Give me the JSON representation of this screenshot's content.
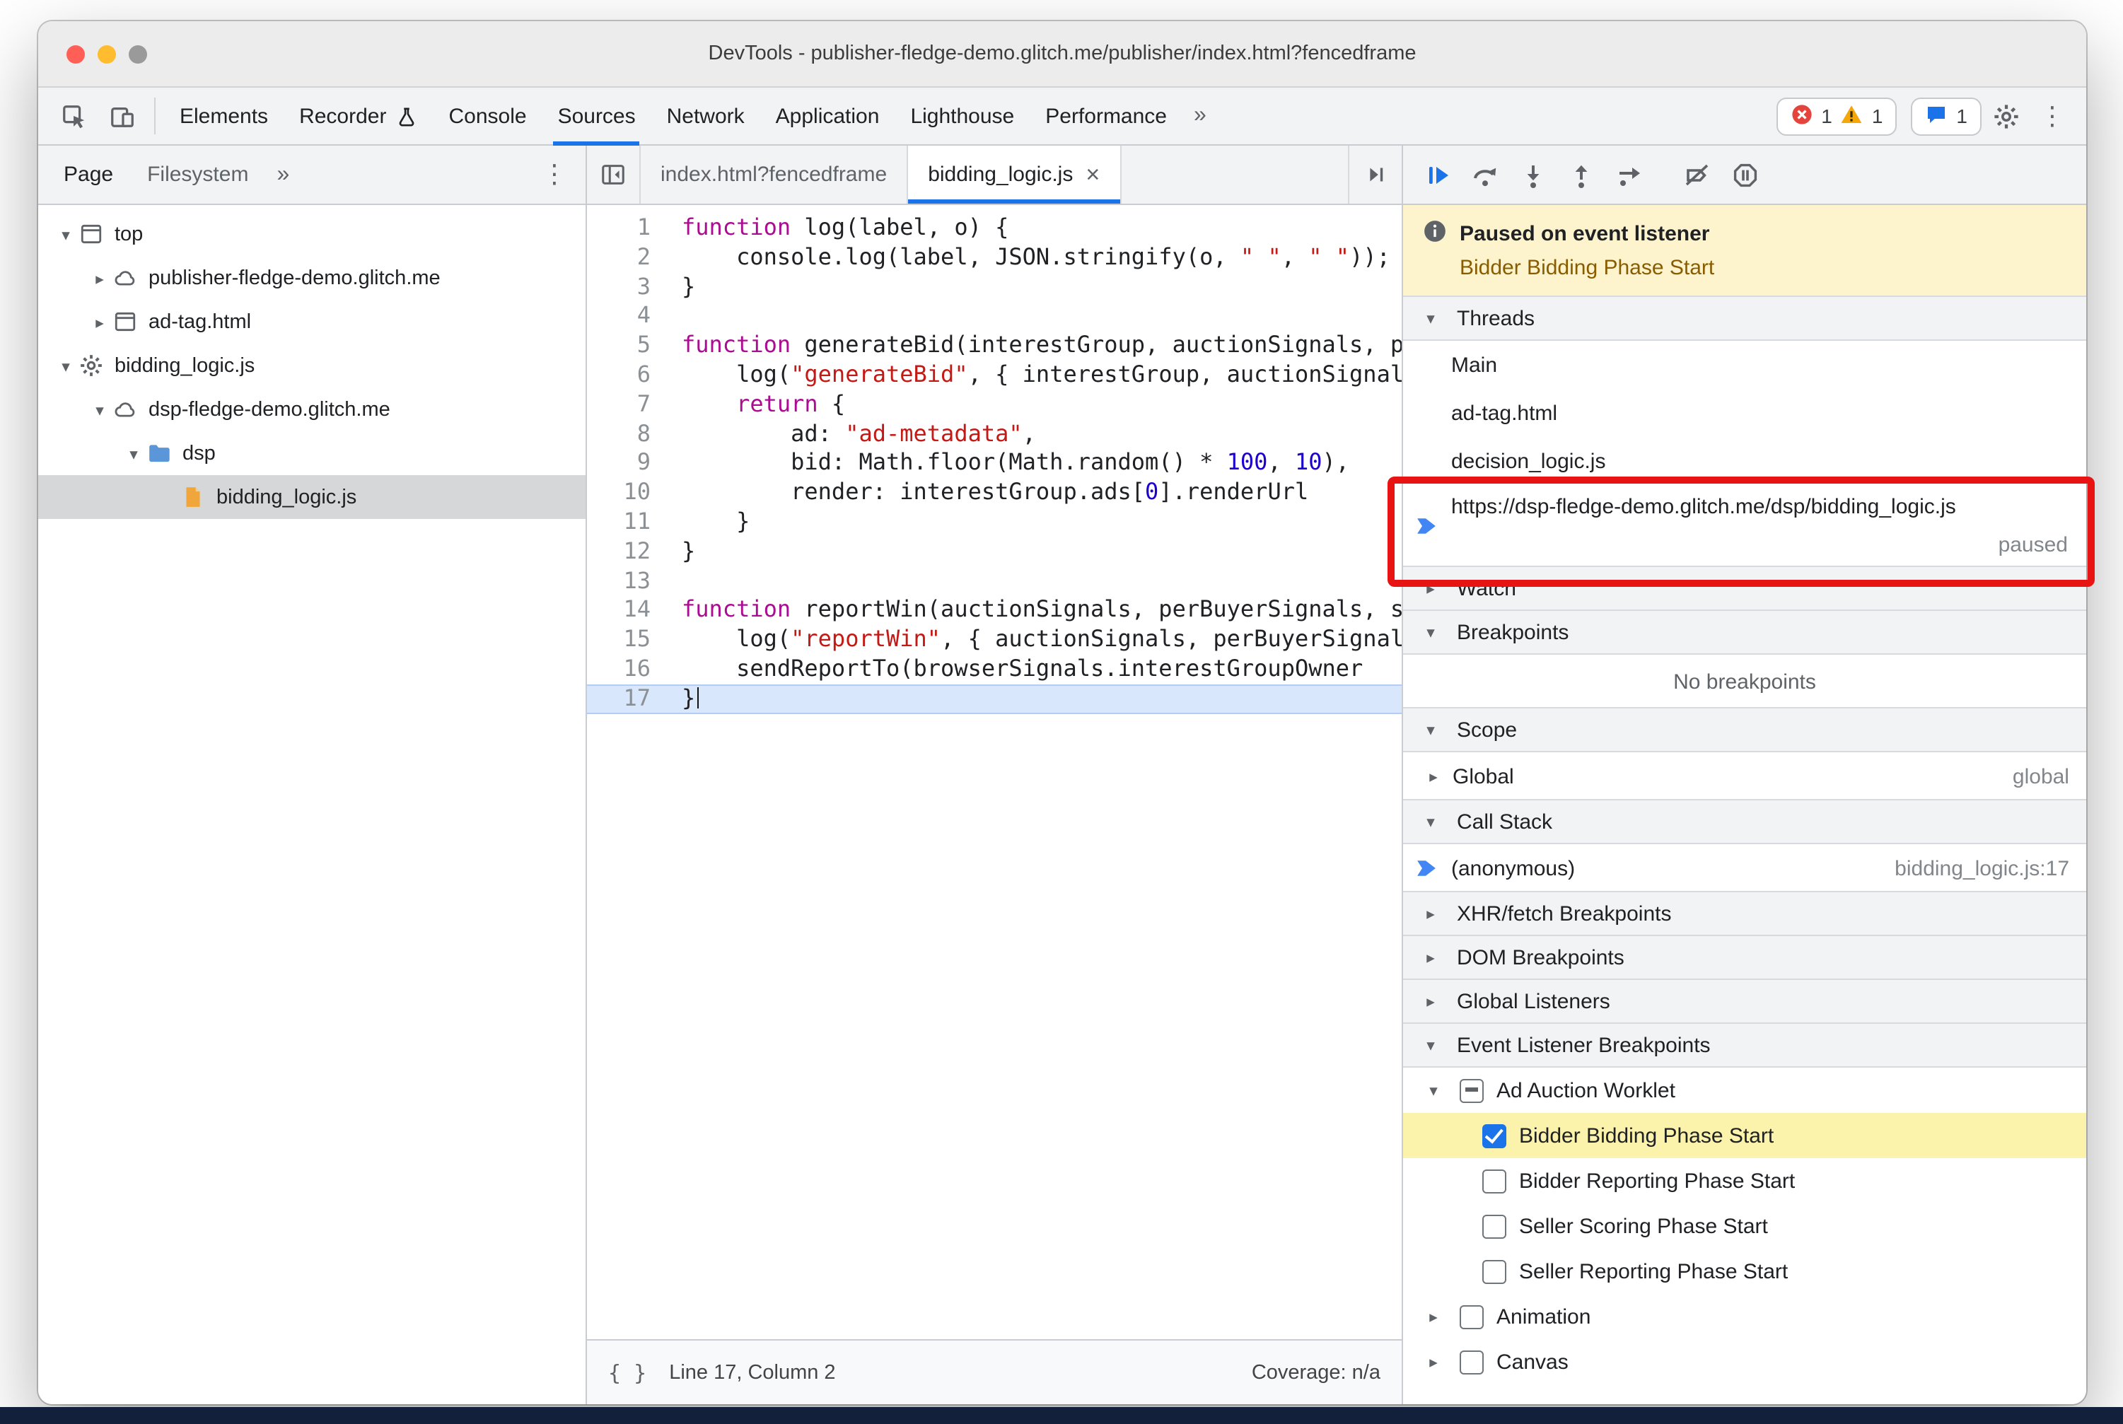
{
  "window": {
    "title": "DevTools - publisher-fledge-demo.glitch.me/publisher/index.html?fencedframe"
  },
  "glyphs": {
    "kebab": "⋮",
    "more": "»",
    "expanded": "▾",
    "collapsed": "▸",
    "close": "×",
    "pretty": "{ }"
  },
  "toolbar": {
    "tabs": [
      "Elements",
      "Recorder",
      "Console",
      "Sources",
      "Network",
      "Application",
      "Lighthouse",
      "Performance"
    ],
    "active_tab": "Sources",
    "error_count": "1",
    "warning_count": "1",
    "issue_count": "1"
  },
  "navigator": {
    "tabs": [
      "Page",
      "Filesystem"
    ],
    "active_tab": "Page",
    "tree": [
      {
        "label": "top",
        "icon": "frame-icon",
        "level": 0,
        "disclosure": "open"
      },
      {
        "label": "publisher-fledge-demo.glitch.me",
        "icon": "cloud-icon",
        "level": 1,
        "disclosure": "closed"
      },
      {
        "label": "ad-tag.html",
        "icon": "frame-icon",
        "level": 1,
        "disclosure": "closed"
      },
      {
        "label": "bidding_logic.js",
        "icon": "gear-icon",
        "level": 0,
        "disclosure": "open"
      },
      {
        "label": "dsp-fledge-demo.glitch.me",
        "icon": "cloud-icon",
        "level": 1,
        "disclosure": "open"
      },
      {
        "label": "dsp",
        "icon": "folder-icon",
        "level": 2,
        "disclosure": "open"
      },
      {
        "label": "bidding_logic.js",
        "icon": "file-icon",
        "level": 3,
        "disclosure": "none",
        "selected": true
      }
    ]
  },
  "editor": {
    "tabs": [
      {
        "label": "index.html?fencedframe",
        "active": false,
        "closable": false
      },
      {
        "label": "bidding_logic.js",
        "active": true,
        "closable": true
      }
    ],
    "current_line": 17,
    "code": [
      {
        "n": 1,
        "seg": [
          [
            "kw",
            "function"
          ],
          [
            "pl",
            " log(label, o) {"
          ]
        ]
      },
      {
        "n": 2,
        "seg": [
          [
            "pl",
            "    console.log(label, JSON.stringify(o, "
          ],
          [
            "str",
            "\" \""
          ],
          [
            "pl",
            ", "
          ],
          [
            "str",
            "\" \""
          ],
          [
            "pl",
            "));"
          ]
        ]
      },
      {
        "n": 3,
        "seg": [
          [
            "pl",
            "}"
          ]
        ]
      },
      {
        "n": 4,
        "seg": []
      },
      {
        "n": 5,
        "seg": [
          [
            "kw",
            "function"
          ],
          [
            "pl",
            " generateBid(interestGroup, auctionSignals, perBuyerSignals,"
          ]
        ]
      },
      {
        "n": 6,
        "seg": [
          [
            "pl",
            "    log("
          ],
          [
            "str",
            "\"generateBid\""
          ],
          [
            "pl",
            ", { interestGroup, auctionSignals, perBuyerSign"
          ]
        ]
      },
      {
        "n": 7,
        "seg": [
          [
            "pl",
            "    "
          ],
          [
            "kw",
            "return"
          ],
          [
            "pl",
            " {"
          ]
        ]
      },
      {
        "n": 8,
        "seg": [
          [
            "pl",
            "        ad: "
          ],
          [
            "str",
            "\"ad-metadata\""
          ],
          [
            "pl",
            ","
          ]
        ]
      },
      {
        "n": 9,
        "seg": [
          [
            "pl",
            "        bid: Math.floor(Math.random() * "
          ],
          [
            "num",
            "100"
          ],
          [
            "pl",
            ", "
          ],
          [
            "num",
            "10"
          ],
          [
            "pl",
            "),"
          ]
        ]
      },
      {
        "n": 10,
        "seg": [
          [
            "pl",
            "        render: interestGroup.ads["
          ],
          [
            "num",
            "0"
          ],
          [
            "pl",
            "].renderUrl"
          ]
        ]
      },
      {
        "n": 11,
        "seg": [
          [
            "pl",
            "    }"
          ]
        ]
      },
      {
        "n": 12,
        "seg": [
          [
            "pl",
            "}"
          ]
        ]
      },
      {
        "n": 13,
        "seg": []
      },
      {
        "n": 14,
        "seg": [
          [
            "kw",
            "function"
          ],
          [
            "pl",
            " reportWin(auctionSignals, perBuyerSignals, sellerSignals,"
          ]
        ]
      },
      {
        "n": 15,
        "seg": [
          [
            "pl",
            "    log("
          ],
          [
            "str",
            "\"reportWin\""
          ],
          [
            "pl",
            ", { auctionSignals, perBuyerSignals, sellerSign"
          ]
        ]
      },
      {
        "n": 16,
        "seg": [
          [
            "pl",
            "    sendReportTo(browserSignals.interestGroupOwner"
          ]
        ]
      },
      {
        "n": 17,
        "seg": [
          [
            "pl",
            "}"
          ]
        ]
      }
    ],
    "status": {
      "line_col": "Line 17, Column 2",
      "coverage": "Coverage: n/a"
    }
  },
  "debugger": {
    "debug_buttons": [
      "resume",
      "step-over",
      "step-into",
      "step-out",
      "step",
      "deactivate-breakpoints",
      "pause-on-exceptions"
    ],
    "paused": {
      "title": "Paused on event listener",
      "event": "Bidder Bidding Phase Start"
    },
    "threads": {
      "title": "Threads",
      "rows": [
        {
          "label": "Main"
        },
        {
          "label": "ad-tag.html"
        },
        {
          "label": "decision_logic.js"
        },
        {
          "label": "https://dsp-fledge-demo.glitch.me/dsp/bidding_logic.js",
          "status": "paused",
          "active": true,
          "annotated": true
        }
      ]
    },
    "watch": {
      "title": "Watch"
    },
    "breakpoints": {
      "title": "Breakpoints",
      "empty": "No breakpoints"
    },
    "scope": {
      "title": "Scope",
      "rows": [
        {
          "label": "Global",
          "right": "global"
        }
      ]
    },
    "call_stack": {
      "title": "Call Stack",
      "rows": [
        {
          "label": "(anonymous)",
          "right": "bidding_logic.js:17",
          "active": true
        }
      ]
    },
    "collapsed_sections": [
      "XHR/fetch Breakpoints",
      "DOM Breakpoints",
      "Global Listeners"
    ],
    "event_listener_breakpoints": {
      "title": "Event Listener Breakpoints",
      "groups": [
        {
          "label": "Ad Auction Worklet",
          "checkbox": "indeterminate",
          "expanded": true,
          "children": [
            {
              "label": "Bidder Bidding Phase Start",
              "checked": true,
              "highlighted": true
            },
            {
              "label": "Bidder Reporting Phase Start",
              "checked": false
            },
            {
              "label": "Seller Scoring Phase Start",
              "checked": false
            },
            {
              "label": "Seller Reporting Phase Start",
              "checked": false
            }
          ]
        },
        {
          "label": "Animation",
          "checkbox": "unchecked",
          "expanded": false,
          "children": []
        },
        {
          "label": "Canvas",
          "checkbox": "unchecked",
          "expanded": false,
          "children": []
        }
      ]
    }
  },
  "colors": {
    "accent": "#1a73e8",
    "error": "#e5443c",
    "warning": "#f5a70a",
    "annotation_red": "#e81414",
    "paused_banner_bg": "#fdf3cd",
    "event_highlight": "#fbf2ab",
    "keyword": "#aa0d91",
    "string": "#c41a16",
    "number": "#1c00cf"
  }
}
